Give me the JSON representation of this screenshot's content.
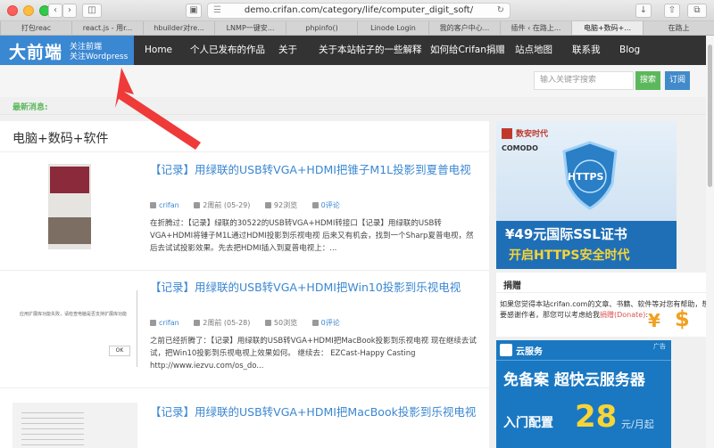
{
  "browser": {
    "url": "demo.crifan.com/category/life/computer_digit_soft/",
    "tabs": [
      "打包reac",
      "react.js - 用r...",
      "hbuilder对re...",
      "LNMP一键安...",
      "phpinfo()",
      "Linode Login",
      "我的客户中心...",
      "插件 ‹ 在路上...",
      "电脑+数码+...",
      "在路上"
    ]
  },
  "site": {
    "logo_main": "大前端",
    "logo_sub1": "关注前端",
    "logo_sub2": "关注Wordpress",
    "nav": [
      "Home",
      "个人已发布的作品",
      "关于",
      "关于本站帖子的一些解释",
      "如何给Crifan捐赠",
      "站点地图",
      "联系我",
      "Blog"
    ],
    "search_placeholder": "输入关键字搜索",
    "search_button": "搜索",
    "subscribe_button": "订阅",
    "news_label": "最新消息:"
  },
  "category_title": "电脑+数码+软件",
  "posts": [
    {
      "title": "【记录】用绿联的USB转VGA+HDMI把锥子M1L投影到夏普电视",
      "author": "crifan",
      "date": "2周前 (05-29)",
      "views": "92浏览",
      "comments": "0评论",
      "excerpt": "在折腾过：【记录】绿联的30522的USB转VGA+HDMI转接口【记录】用绿联的USB转VGA+HDMI将锤子M1L通过HDMI投影到乐视电视 后来又有机会，找到一个Sharp夏普电视，然后去试试投影效果。先去把HDMI插入到夏普电视上：..."
    },
    {
      "title": "【记录】用绿联的USB转VGA+HDMI把Win10投影到乐视电视",
      "author": "crifan",
      "date": "2周前 (05-28)",
      "views": "50浏览",
      "comments": "0评论",
      "excerpt": "之前已经折腾了：【记录】用绿联的USB转VGA+HDMI把MacBook投影到乐视电视 现在继续去试试，把Win10投影到乐视电视上效果如何。 继续去： EZCast-Happy Casting http://www.iezvu.com/os_do...",
      "thumb_text": "应用扩展库功能失败，请检查电脑是否支持扩展库功能",
      "thumb_ok": "OK"
    },
    {
      "title": "【记录】用绿联的USB转VGA+HDMI把MacBook投影到乐视电视"
    }
  ],
  "sidebar": {
    "ad1": {
      "brand": "数安时代",
      "comodo": "COMODO",
      "https": "HTTPS",
      "line1": "¥49元国际SSL证书",
      "line2": "开启HTTPS安全时代"
    },
    "donate": {
      "title": "捐赠",
      "text": "如果您觉得本站crifan.com的文章、书籍、软件等对您有帮助，想要感谢作者，那您可以考虑给我",
      "link": "捐赠(Donate)",
      "tail": ":"
    },
    "ad2": {
      "brand": "云服务",
      "tag": "广告",
      "line1": "免备案 超快云服务器",
      "line2_prefix": "入门配置",
      "price": "28",
      "unit": "元/月起"
    }
  }
}
